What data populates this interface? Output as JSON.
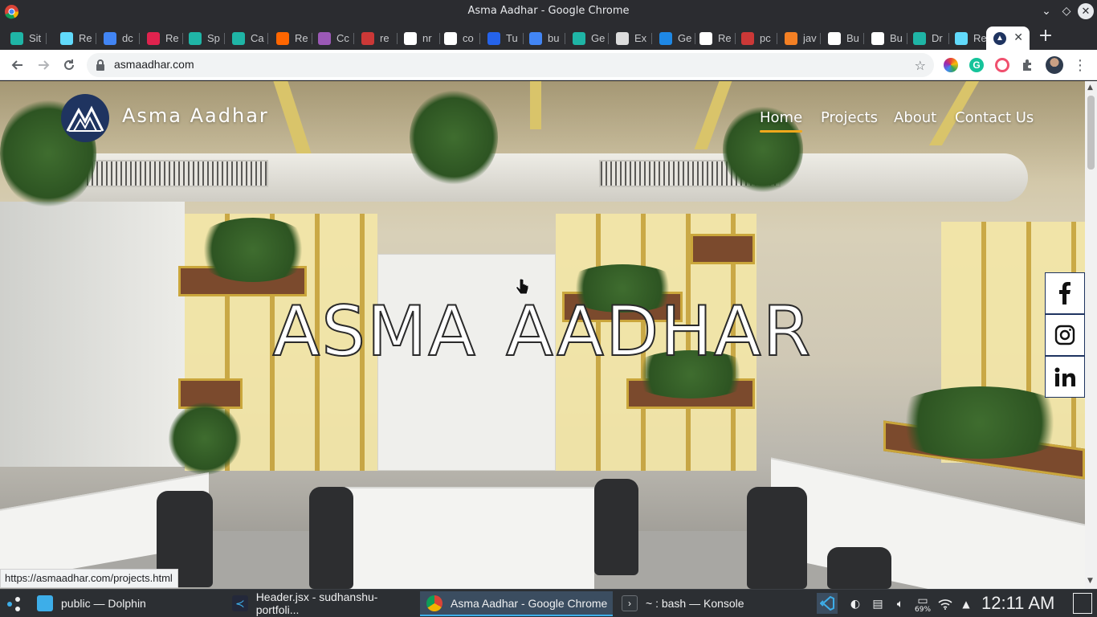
{
  "window": {
    "title": "Asma Aadhar - Google Chrome"
  },
  "tabs": [
    {
      "label": "Sit",
      "icon": "diamond-teal-icon",
      "color": "#1fb5a6"
    },
    {
      "label": "Re",
      "icon": "react-icon",
      "color": "#61dafb"
    },
    {
      "label": "dc",
      "icon": "google-icon",
      "color": "#4285f4"
    },
    {
      "label": "Re",
      "icon": "redux-saga-icon",
      "color": "#e0234e"
    },
    {
      "label": "Sp",
      "icon": "teal-leaf-icon",
      "color": "#1fb5a6"
    },
    {
      "label": "Ca",
      "icon": "teal-leaf-icon",
      "color": "#1fb5a6"
    },
    {
      "label": "Re",
      "icon": "ycombinator-icon",
      "color": "#ff6600"
    },
    {
      "label": "Cc",
      "icon": "check-circle-icon",
      "color": "#9b59b6"
    },
    {
      "label": "re",
      "icon": "npm-icon",
      "color": "#cb3837"
    },
    {
      "label": "nr",
      "icon": "github-icon",
      "color": "#ffffff"
    },
    {
      "label": "co",
      "icon": "github-icon",
      "color": "#ffffff"
    },
    {
      "label": "Tu",
      "icon": "shield-blue-icon",
      "color": "#2563eb"
    },
    {
      "label": "bu",
      "icon": "google-icon",
      "color": "#4285f4"
    },
    {
      "label": "Ge",
      "icon": "teal-leaf-icon",
      "color": "#1fb5a6"
    },
    {
      "label": "Ex",
      "icon": "document-icon",
      "color": "#dddddd"
    },
    {
      "label": "Ge",
      "icon": "gear-blue-icon",
      "color": "#1e88e5"
    },
    {
      "label": "Re",
      "icon": "github-icon",
      "color": "#ffffff"
    },
    {
      "label": "pc",
      "icon": "npm-icon",
      "color": "#cb3837"
    },
    {
      "label": "jav",
      "icon": "stackoverflow-icon",
      "color": "#f48024"
    },
    {
      "label": "Bu",
      "icon": "codesandbox-icon",
      "color": "#ffffff"
    },
    {
      "label": "Bu",
      "icon": "codesandbox-icon",
      "color": "#ffffff"
    },
    {
      "label": "Dr",
      "icon": "teal-leaf-icon",
      "color": "#1fb5a6"
    },
    {
      "label": "Re",
      "icon": "react-icon",
      "color": "#61dafb"
    }
  ],
  "toolbar": {
    "url": "asmaadhar.com"
  },
  "site": {
    "name": "Asma Aadhar",
    "nav": [
      "Home",
      "Projects",
      "About",
      "Contact Us"
    ],
    "hero": [
      "ASMA",
      "AADHAR"
    ],
    "social": [
      "facebook-icon",
      "instagram-icon",
      "linkedin-icon"
    ]
  },
  "status_url": "https://asmaadhar.com/projects.html",
  "taskbar": {
    "tasks": [
      "public — Dolphin",
      "Header.jsx - sudhanshu-portfoli...",
      "Asma Aadhar - Google Chrome",
      "~ : bash — Konsole"
    ],
    "clock": "12:11 AM",
    "battery": "69%"
  },
  "colors": {
    "brand_navy": "#1f3460",
    "nav_active_underline": "#f0a81c",
    "taskbar_accent": "#3daee9"
  }
}
